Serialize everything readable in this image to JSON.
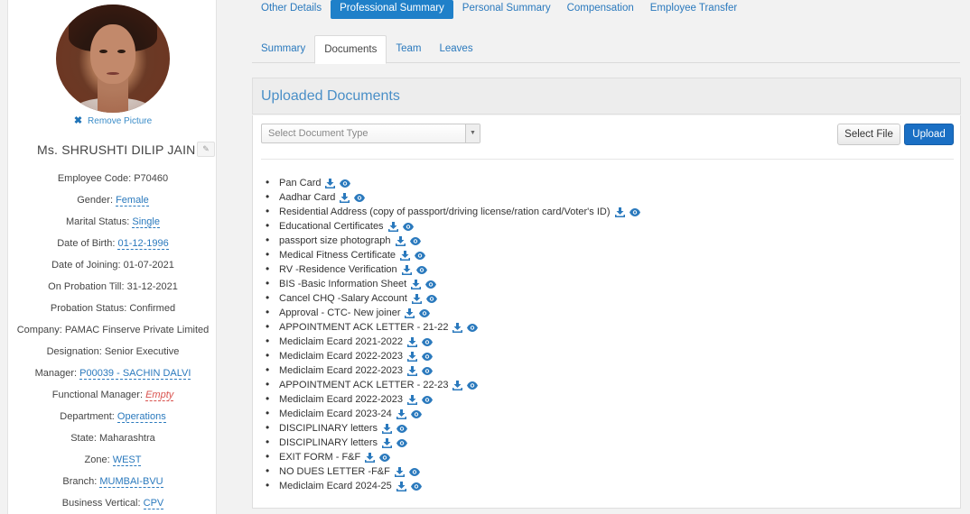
{
  "profile": {
    "remove_picture": "Remove Picture",
    "name": "Ms. SHRUSHTI DILIP JAIN",
    "fields": [
      {
        "label": "Employee Code:",
        "value": "P70460",
        "style": "plain"
      },
      {
        "label": "Gender:",
        "value": "Female",
        "style": "link"
      },
      {
        "label": "Marital Status:",
        "value": "Single",
        "style": "link"
      },
      {
        "label": "Date of Birth:",
        "value": "01-12-1996",
        "style": "link"
      },
      {
        "label": "Date of Joining:",
        "value": "01-07-2021",
        "style": "plain"
      },
      {
        "label": "On Probation Till:",
        "value": "31-12-2021",
        "style": "plain"
      },
      {
        "label": "Probation Status:",
        "value": "Confirmed",
        "style": "plain"
      },
      {
        "label": "Company:",
        "value": "PAMAC Finserve Private Limited",
        "style": "plain"
      },
      {
        "label": "Designation:",
        "value": "Senior Executive",
        "style": "plain"
      },
      {
        "label": "Manager:",
        "value": "P00039 - SACHIN DALVI",
        "style": "link"
      },
      {
        "label": "Functional Manager:",
        "value": "Empty",
        "style": "empty"
      },
      {
        "label": "Department:",
        "value": "Operations",
        "style": "link"
      },
      {
        "label": "State:",
        "value": "Maharashtra",
        "style": "plain"
      },
      {
        "label": "Zone:",
        "value": "WEST",
        "style": "link"
      },
      {
        "label": "Branch:",
        "value": "MUMBAI-BVU",
        "style": "link"
      },
      {
        "label": "Business Vertical:",
        "value": "CPV",
        "style": "link"
      }
    ]
  },
  "top_tabs": [
    {
      "label": "Other Details",
      "active": false
    },
    {
      "label": "Professional Summary",
      "active": true
    },
    {
      "label": "Personal Summary",
      "active": false
    },
    {
      "label": "Compensation",
      "active": false
    },
    {
      "label": "Employee Transfer",
      "active": false
    }
  ],
  "sub_tabs": [
    {
      "label": "Summary",
      "active": false
    },
    {
      "label": "Documents",
      "active": true
    },
    {
      "label": "Team",
      "active": false
    },
    {
      "label": "Leaves",
      "active": false
    }
  ],
  "documents": {
    "title": "Uploaded Documents",
    "select_placeholder": "Select Document Type",
    "select_file_label": "Select File",
    "upload_label": "Upload",
    "items": [
      "Pan Card",
      "Aadhar Card",
      "Residential Address (copy of passport/driving license/ration card/Voter's ID)",
      "Educational Certificates",
      "passport size photograph",
      "Medical Fitness Certificate",
      "RV -Residence Verification",
      "BIS -Basic Information Sheet",
      "Cancel CHQ -Salary Account",
      "Approval - CTC- New joiner",
      "APPOINTMENT ACK LETTER - 21-22",
      "Mediclaim Ecard 2021-2022",
      "Mediclaim Ecard 2022-2023",
      "Mediclaim Ecard 2022-2023",
      "APPOINTMENT ACK LETTER - 22-23",
      "Mediclaim Ecard 2022-2023",
      "Mediclaim Ecard 2023-24",
      "DISCIPLINARY letters",
      "DISCIPLINARY letters",
      "EXIT FORM - F&F",
      "NO DUES LETTER -F&F",
      "Mediclaim Ecard 2024-25"
    ]
  },
  "colors": {
    "accent": "#1f80c9",
    "link": "#2a79bd",
    "icon": "#2a79bd",
    "empty": "#d9534f"
  },
  "icons": {
    "download": "download-icon",
    "view": "eye-icon",
    "remove": "close-icon",
    "edit": "pencil-icon"
  }
}
